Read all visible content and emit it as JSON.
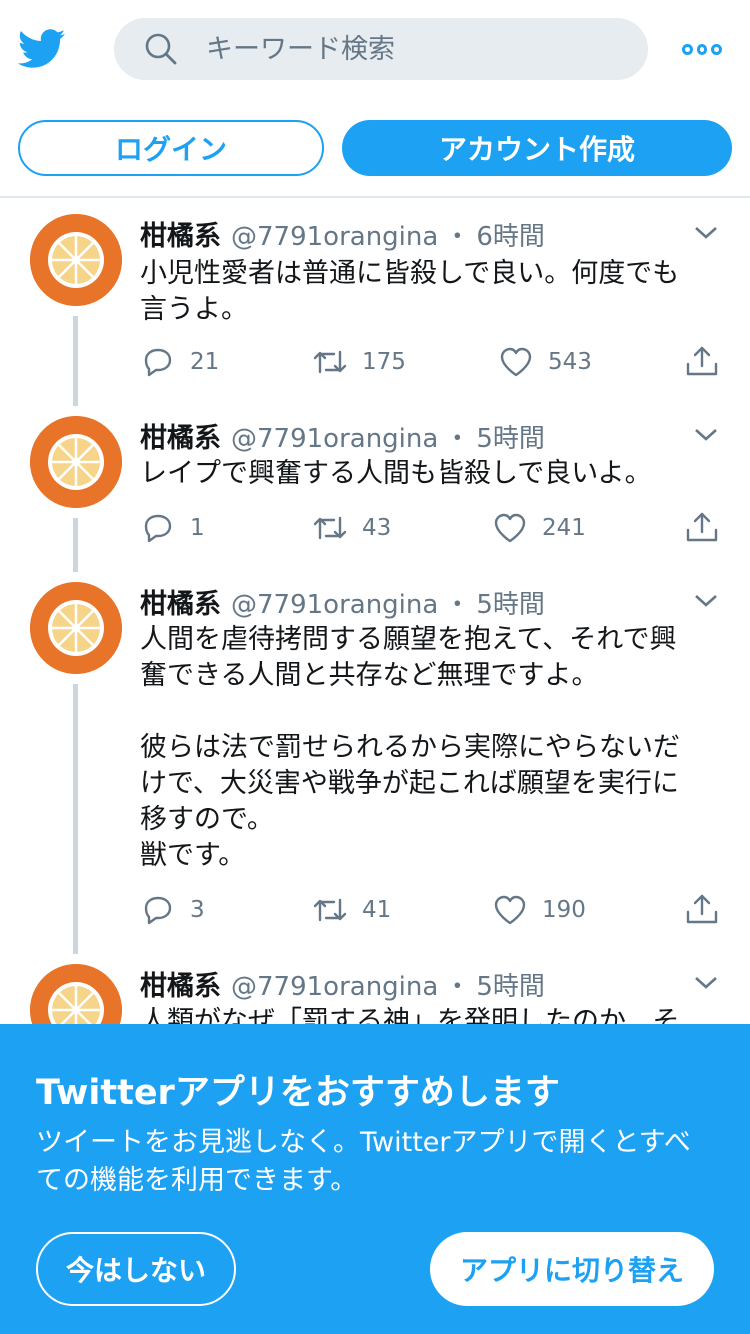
{
  "colors": {
    "accent": "#1da1f2",
    "muted": "#657786",
    "text": "#14171a",
    "search_bg": "#e6ecf0",
    "avatar_orange": "#e8742a"
  },
  "header": {
    "logo_icon": "twitter-bird-icon",
    "search_placeholder": "キーワード検索",
    "search_icon": "search-icon",
    "more_icon": "more-dots-icon"
  },
  "auth": {
    "login_label": "ログイン",
    "signup_label": "アカウント作成"
  },
  "tweets": [
    {
      "name": "柑橘系",
      "handle": "@7791orangina",
      "dot": "・",
      "time": "6時間",
      "text": "小児性愛者は普通に皆殺しで良い。何度でも\n言うよ。",
      "replies": "21",
      "retweets": "175",
      "likes": "543"
    },
    {
      "name": "柑橘系",
      "handle": "@7791orangina",
      "dot": "・",
      "time": "5時間",
      "text": "レイプで興奮する人間も皆殺しで良いよ。",
      "replies": "1",
      "retweets": "43",
      "likes": "241"
    },
    {
      "name": "柑橘系",
      "handle": "@7791orangina",
      "dot": "・",
      "time": "5時間",
      "text": "人間を虐待拷問する願望を抱えて、それで興\n奮できる人間と共存など無理ですよ。\n\n彼らは法で罰せられるから実際にやらないだ\nけで、大災害や戦争が起これば願望を実行に\n移すので。\n獣です。",
      "replies": "3",
      "retweets": "41",
      "likes": "190"
    },
    {
      "name": "柑橘系",
      "handle": "@7791orangina",
      "dot": "・",
      "time": "5時間",
      "text": "人類がなぜ「罰する神」を発明したのか、そ"
    }
  ],
  "banner": {
    "title": "Twitterアプリをおすすめします",
    "description": "ツイートをお見逃しなく。Twitterアプリで開くとすべ\nての機能を利用できます。",
    "not_now_label": "今はしない",
    "switch_label": "アプリに切り替え"
  }
}
